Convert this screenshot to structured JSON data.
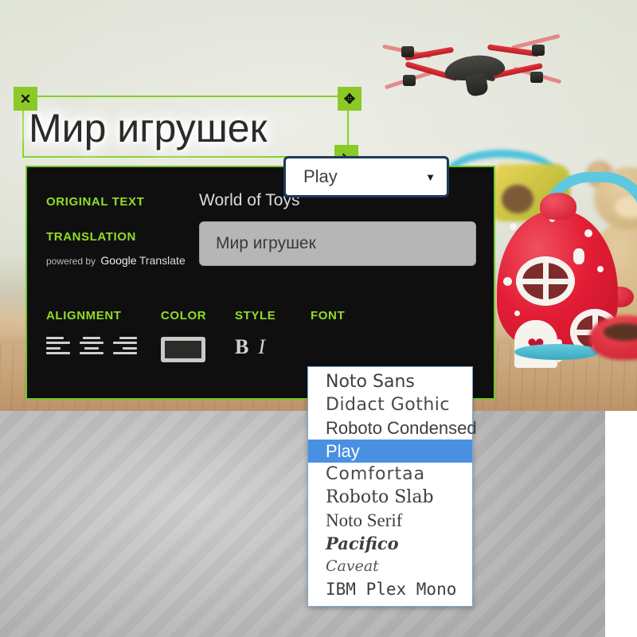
{
  "overlay": {
    "text": "Мир игрушек",
    "handles": {
      "close": "✕",
      "move": "✥",
      "resize": "↘"
    }
  },
  "panel": {
    "original_label": "ORIGINAL TEXT",
    "original_value": "World of Toys",
    "translation_label": "TRANSLATION",
    "powered_prefix": "powered by",
    "powered_brand": "Google",
    "powered_suffix": "Translate",
    "translation_value": "Мир игрушек",
    "controls": {
      "alignment_label": "ALIGNMENT",
      "color_label": "COLOR",
      "style_label": "STYLE",
      "font_label": "FONT",
      "bold_label": "B",
      "italic_label": "I",
      "color_value": "#2b2b27",
      "accent_color": "#8ede27",
      "panel_border_color": "#74c72a"
    }
  },
  "font_select": {
    "value": "Play",
    "caret": "▼",
    "options": [
      {
        "label": "Noto Sans",
        "cls": "f-sans",
        "selected": false
      },
      {
        "label": "Didact Gothic",
        "cls": "f-didact",
        "selected": false
      },
      {
        "label": "Roboto Condensed",
        "cls": "f-condensed",
        "selected": false
      },
      {
        "label": "Play",
        "cls": "f-play",
        "selected": true
      },
      {
        "label": "Comfortaa",
        "cls": "f-comfortaa",
        "selected": false
      },
      {
        "label": "Roboto Slab",
        "cls": "f-slab",
        "selected": false
      },
      {
        "label": "Noto Serif",
        "cls": "f-serif",
        "selected": false
      },
      {
        "label": "Pacifico",
        "cls": "f-pacifico",
        "selected": false
      },
      {
        "label": "Caveat",
        "cls": "f-caveat",
        "selected": false
      },
      {
        "label": "IBM Plex Mono",
        "cls": "f-mono",
        "selected": false
      }
    ]
  },
  "photo": {
    "description": "Red and black quadcopter drone flying above a red polka-dot toy house and teddy bear on a wooden floor"
  }
}
